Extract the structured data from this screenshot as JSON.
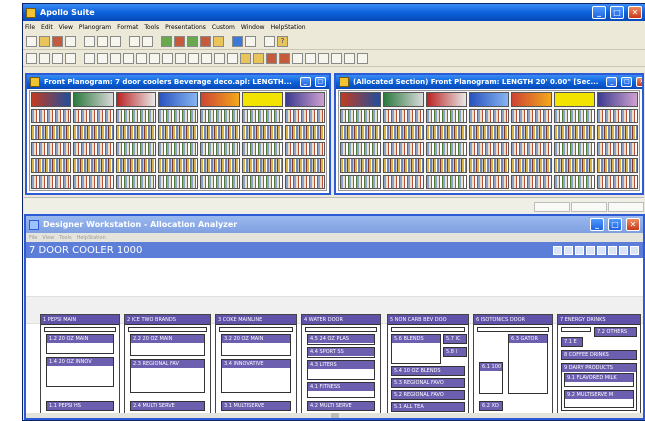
{
  "app": {
    "title": "Apollo Suite",
    "menu": [
      "File",
      "Edit",
      "View",
      "Planogram",
      "Format",
      "Tools",
      "Presentations",
      "Custom",
      "Window",
      "HelpStation"
    ]
  },
  "windows": {
    "left": {
      "title": "Front Planogram: 7 door coolers Beverage deco.apl: LENGTH..."
    },
    "right": {
      "title": "(Allocated Section) Front Planogram: LENGTH 20' 0.00\" [Sec..."
    }
  },
  "designer": {
    "title": "Designer Workstation - Allocation Analyzer",
    "menu": [
      "File",
      "View",
      "Tools",
      "HelpStation"
    ],
    "header": "7 DOOR COOLER 1000"
  },
  "categories": [
    {
      "label": "1 PEPSI MAIN",
      "subs": [
        "1.2 20 OZ MAIN",
        "1.4 20 OZ INNOV",
        "1.1 PEPSI HS"
      ]
    },
    {
      "label": "2 ICE TWO BRANDS",
      "subs": [
        "2.2 20 OZ MAIN",
        "2.3 REGIONAL FAV",
        "2.4 MULTI SERVE"
      ]
    },
    {
      "label": "3 COKE MAINLINE",
      "subs": [
        "3.2 20 OZ MAIN",
        "3.4 INNOVATIVE",
        "3.1 MULTISERVE"
      ]
    },
    {
      "label": "4 WATER DOOR",
      "subs": [
        "4.5 24 OZ PLAS",
        "4.4 SPORT SS",
        "4.3 LITERS",
        "4.1 FITNESS",
        "4.2 MULTI SERVE"
      ]
    },
    {
      "label": "5 NON CARB BEV DOO",
      "subs": [
        "5.6 BLENDS",
        "5.7 IC",
        "5.8 I",
        "5.4 10 OZ BLENDS",
        "5.3 REGIONAL FAVO",
        "5.2 REGIONAL FAVO",
        "5.1 ALL TEA"
      ]
    },
    {
      "label": "6 ISOTONICS DOOR",
      "subs": [
        "6.3 GATOR",
        "6.1 100",
        "6.2 XD"
      ]
    },
    {
      "label": "7 ENERGY DRINKS",
      "subs": [
        "7.2 OTHERS",
        "7.1 E",
        "8 COFFEE DRINKS",
        "9 DAIRY PRODUCTS",
        "9.1 FLAVORED MILK",
        "9.2 MULTISERVE M"
      ]
    }
  ],
  "colors": {
    "xp_title": "#0a5fd8",
    "category_label": "#5f52a8",
    "designer_header": "#5c7ed8"
  },
  "icons": [
    "new-icon",
    "open-icon",
    "save-icon",
    "print-icon",
    "cut-icon",
    "copy-icon",
    "paste-icon",
    "pointer-icon",
    "zoom-icon",
    "shelf-icon",
    "fixture-icon",
    "help-icon"
  ]
}
